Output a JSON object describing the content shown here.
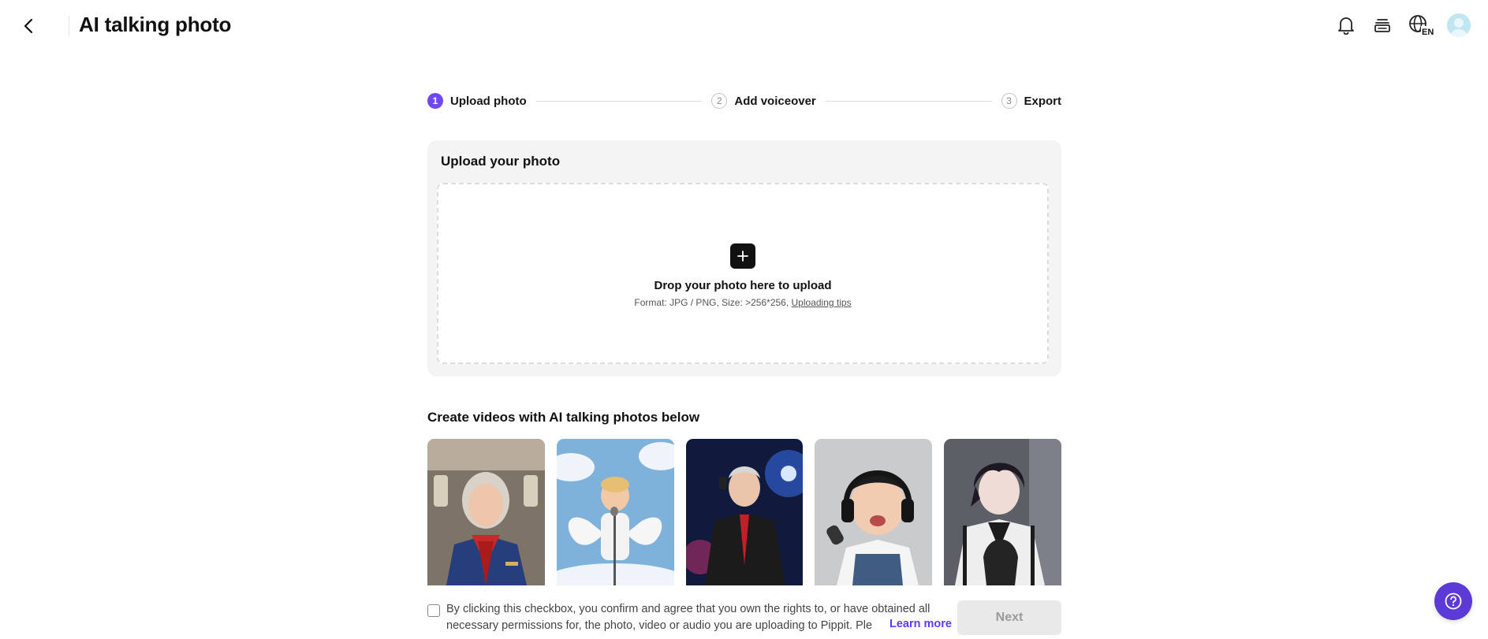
{
  "header": {
    "title": "AI talking photo",
    "icons": [
      "back-arrow-icon",
      "bell-icon",
      "layers-icon",
      "globe-language-icon",
      "avatar"
    ],
    "language_badge": "EN"
  },
  "stepper": {
    "steps": [
      {
        "number": "1",
        "label": "Upload photo",
        "state": "active"
      },
      {
        "number": "2",
        "label": "Add voiceover",
        "state": "inactive"
      },
      {
        "number": "3",
        "label": "Export",
        "state": "inactive"
      }
    ],
    "active_color": "#6e48f0"
  },
  "upload": {
    "title": "Upload your photo",
    "drop_text": "Drop your photo here to upload",
    "format_text": "Format: JPG / PNG, Size: >256*256, ",
    "tips_link": "Uploading tips"
  },
  "examples": {
    "title": "Create videos with AI talking photos below",
    "items": [
      {
        "subject": "flight attendant"
      },
      {
        "subject": "angel toddler singing"
      },
      {
        "subject": "singer on stage"
      },
      {
        "subject": "baby with headphones"
      },
      {
        "subject": "anime style young man"
      }
    ]
  },
  "footer": {
    "consent_text": "By clicking this checkbox, you confirm and agree that you own the rights to, or have obtained all necessary permissions for, the photo, video or audio you are uploading to Pippit. Ple",
    "learn_more": "Learn more",
    "next_label": "Next",
    "consent_checked": false
  },
  "help": {
    "icon": "help-icon",
    "color": "#5b3ad6"
  }
}
